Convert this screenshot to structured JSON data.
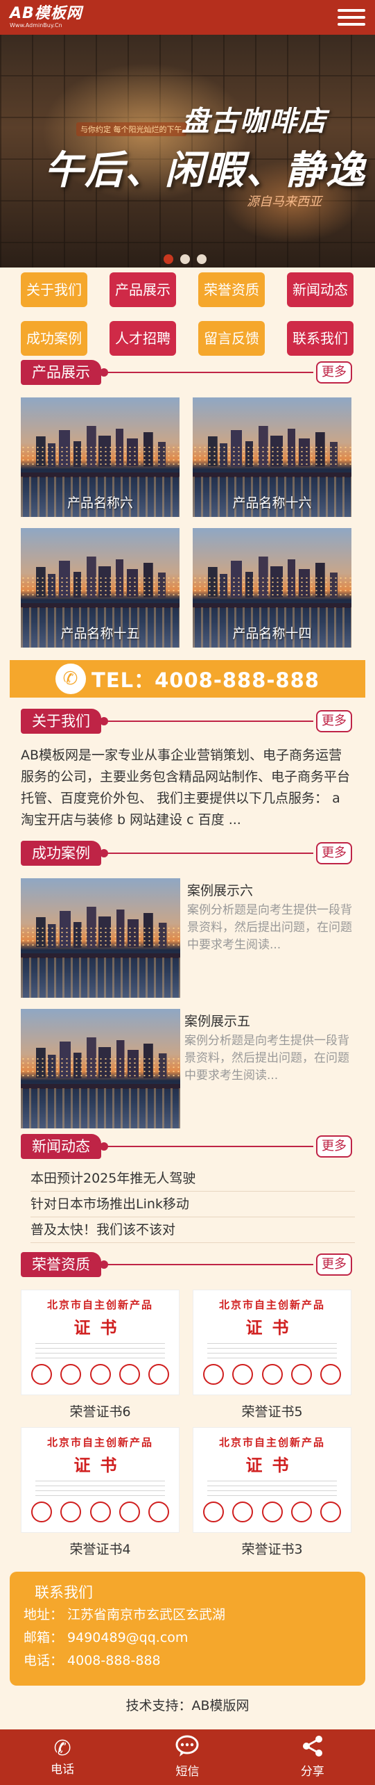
{
  "header": {
    "logo_main": "AB模板网",
    "logo_sub": "Www.AdminBuy.Cn"
  },
  "banner": {
    "tagline": "与你约定 每个阳光灿烂的下午",
    "title1": "盘古咖啡店",
    "title2": "午后、闲暇、静逸",
    "source": "源自马来西亚"
  },
  "nav": [
    "关于我们",
    "产品展示",
    "荣誉资质",
    "新闻动态",
    "成功案例",
    "人才招聘",
    "留言反馈",
    "联系我们"
  ],
  "more_label": "更多",
  "products": {
    "title": "产品展示",
    "items": [
      "产品名称六",
      "产品名称十六",
      "产品名称十五",
      "产品名称十四"
    ]
  },
  "tel": {
    "text": "TEL：4008-888-888"
  },
  "about": {
    "title": "关于我们",
    "text": "AB模板网是一家专业从事企业营销策划、电子商务运营服务的公司，主要业务包含精品网站制作、电子商务平台托管、百度竞价外包、 我们主要提供以下几点服务： a 淘宝开店与装修 b 网站建设 c 百度 ..."
  },
  "cases": {
    "title": "成功案例",
    "items": [
      {
        "title": "案例展示六",
        "desc": "案例分析题是向考生提供一段背景资料，然后提出问题，在问题中要求考生阅读..."
      },
      {
        "title": "案例展示五",
        "desc": "案例分析题是向考生提供一段背景资料，然后提出问题，在问题中要求考生阅读..."
      }
    ]
  },
  "news": {
    "title": "新闻动态",
    "items": [
      "本田预计2025年推无人驾驶",
      "针对日本市场推出Link移动",
      "普及太快！我们该不该对"
    ]
  },
  "honors": {
    "title": "荣誉资质",
    "cert_header": "北京市自主创新产品",
    "cert_title": "证书",
    "items": [
      "荣誉证书6",
      "荣誉证书5",
      "荣誉证书4",
      "荣誉证书3"
    ]
  },
  "contact": {
    "title": "联系我们",
    "address": "地址： 江苏省南京市玄武区玄武湖",
    "email": "邮箱： 9490489@qq.com",
    "phone": "电话： 4008-888-888"
  },
  "support": "技术支持：AB模版网",
  "bottom": {
    "call": "电话",
    "sms": "短信",
    "share": "分享"
  },
  "colors": {
    "header": "#b52f1d",
    "accent_red": "#bf2446",
    "accent_orange": "#f5a72c",
    "background": "#fdf3e4"
  },
  "icons": {
    "menu": "hamburger-icon",
    "phone": "phone-icon",
    "sms": "chat-bubble-icon",
    "share": "share-icon"
  }
}
